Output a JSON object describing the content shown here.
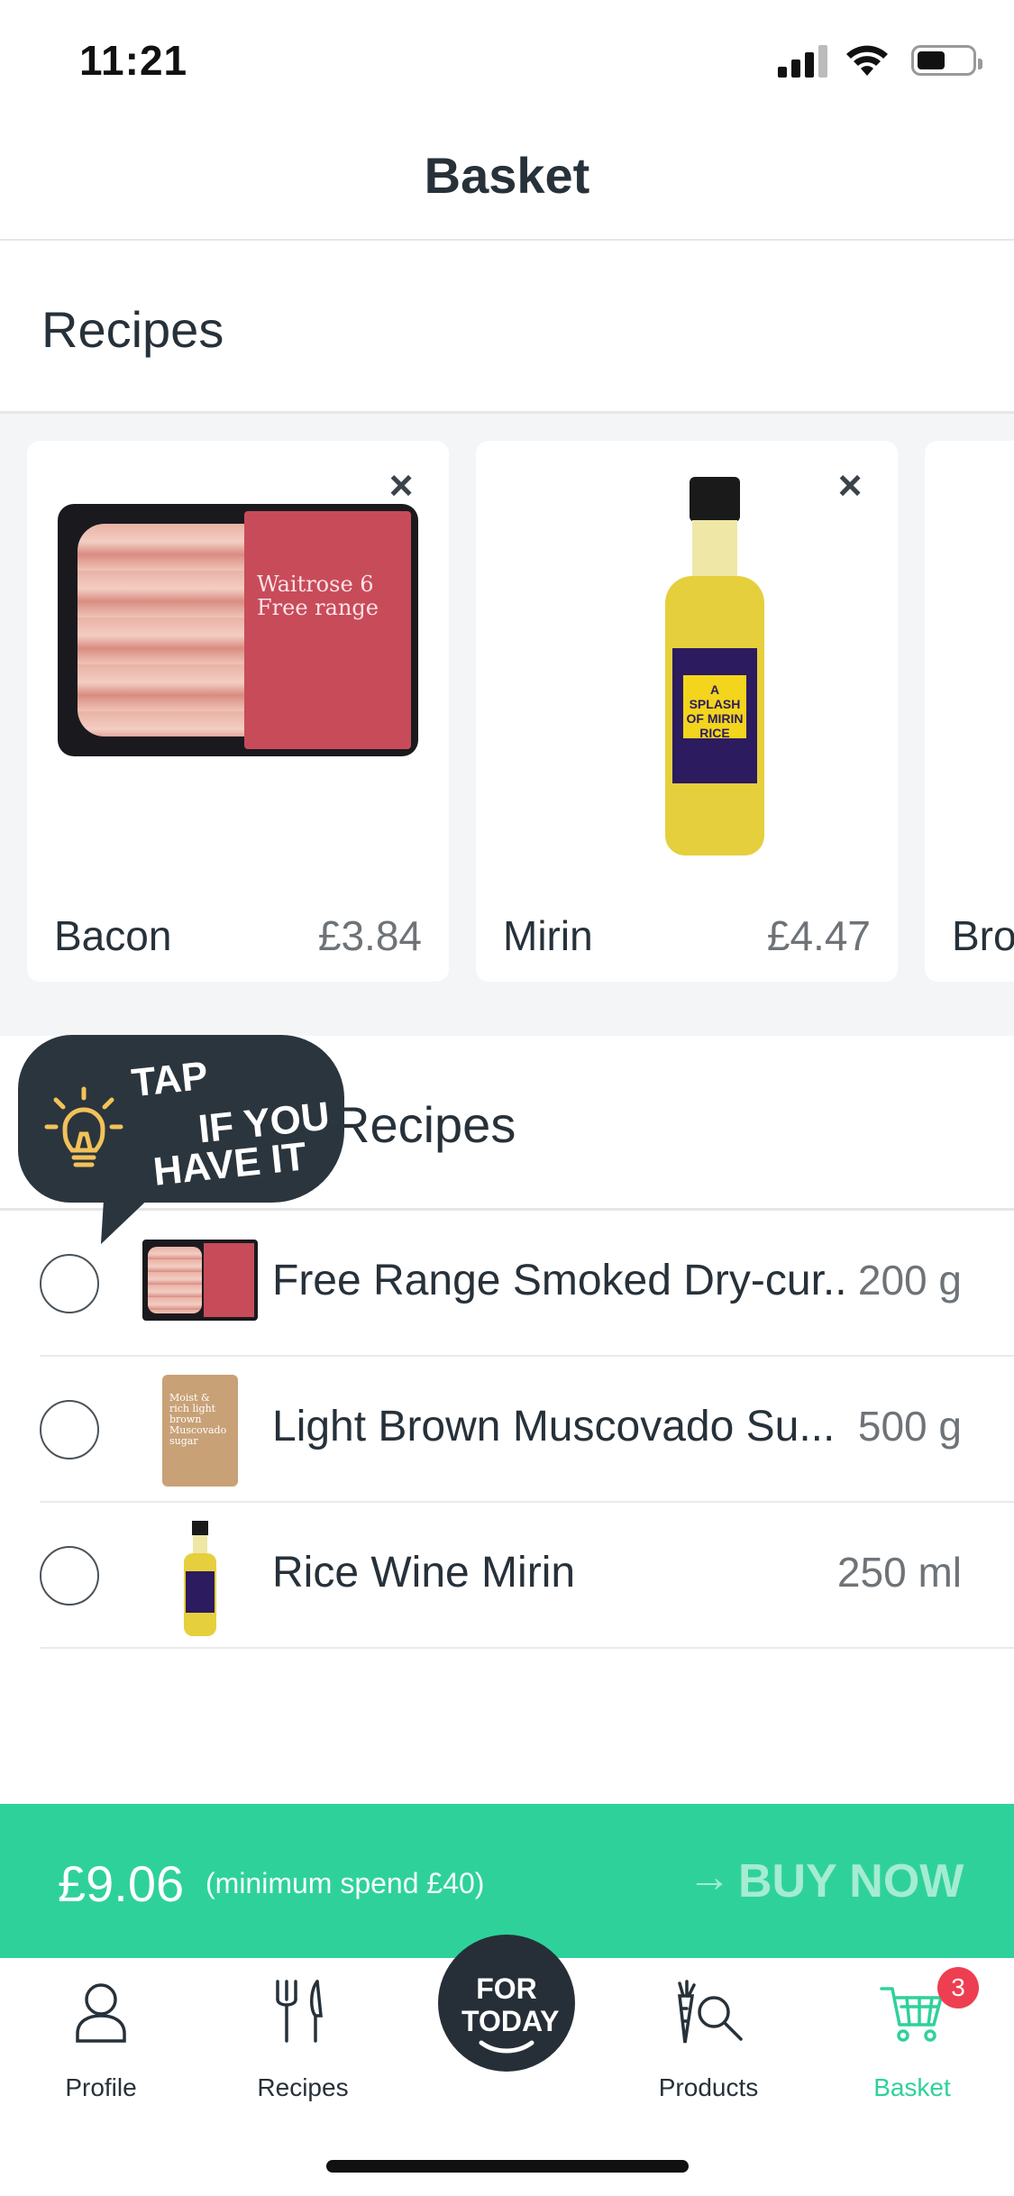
{
  "status_bar": {
    "time": "11:21"
  },
  "header": {
    "title": "Basket"
  },
  "recipes_section": {
    "title": "Recipes"
  },
  "cards": [
    {
      "name": "Bacon",
      "price": "£3.84",
      "close": "×",
      "package_text": "Waitrose 6 Free range"
    },
    {
      "name": "Mirin",
      "price": "£4.47",
      "close": "×",
      "package_text": "A SPLASH OF MIRIN RICE WINE"
    },
    {
      "name": "Bro"
    }
  ],
  "ingredients_section": {
    "title": "Recipes"
  },
  "tooltip": {
    "line1": "TAP",
    "line2": "IF YOU",
    "line3": "HAVE IT"
  },
  "ingredients": [
    {
      "name": "Free Range Smoked Dry-cur...",
      "qty": "200 g"
    },
    {
      "name": "Light Brown Muscovado Su...",
      "qty": "500 g",
      "package_text": "Moist & rich light brown Muscovado sugar"
    },
    {
      "name": "Rice Wine Mirin",
      "qty": "250 ml"
    }
  ],
  "buy_bar": {
    "total": "£9.06",
    "minimum": "(minimum spend £40)",
    "button": "BUY NOW",
    "arrow": "→"
  },
  "tabs": [
    {
      "label": "Profile",
      "icon": "person-icon"
    },
    {
      "label": "Recipes",
      "icon": "cutlery-icon"
    },
    {
      "label": "FOR TODAY",
      "icon": "for-today-badge"
    },
    {
      "label": "Products",
      "icon": "carrot-search-icon"
    },
    {
      "label": "Basket",
      "icon": "cart-icon",
      "active": true,
      "badge": "3"
    }
  ],
  "colors": {
    "accent": "#2fd19b",
    "dark": "#27313a",
    "badge": "#ee3e52"
  }
}
